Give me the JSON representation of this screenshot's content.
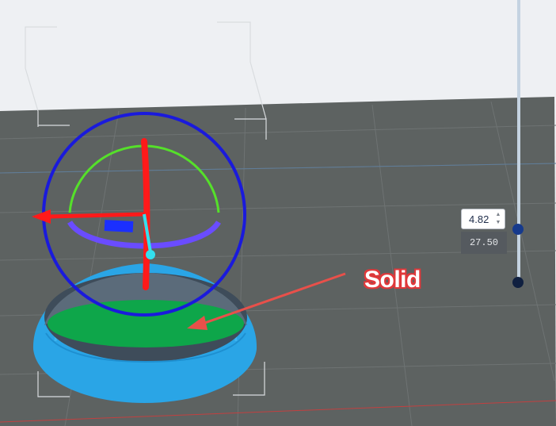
{
  "viewport": {
    "background_color": "#eef0f3",
    "bed_color": "#5d6261",
    "grid_color": "#6e7373",
    "model_color": "#2aa5e6",
    "top_face_color": "#0ea64a",
    "gizmo": {
      "rotate_ring_color": "#1a1adc",
      "x_axis_color": "#ff1a1a",
      "y_axis_color": "#ff1a1a",
      "z_axis_color": "#33e0ee",
      "arc_color": "#55e02a",
      "base_ring_color": "#6a4cff",
      "plane_handle_color": "#1b2fff"
    }
  },
  "layer_slider": {
    "current_value": "4.82",
    "layer_height_text": "27.50",
    "track_color": "#c4d3e1",
    "upper_handle_color": "#163a8c",
    "lower_handle_color": "#102040",
    "icons": {
      "increment": "chevron-up-icon",
      "decrement": "chevron-down-icon"
    }
  },
  "annotation": {
    "label": "Solid",
    "arrow_color": "#e8504a"
  }
}
